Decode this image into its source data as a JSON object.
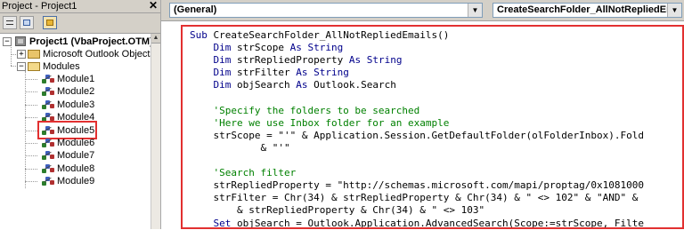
{
  "explorer": {
    "title": "Project - Project1",
    "close_glyph": "✕",
    "toolbar": [
      {
        "name": "view-code-button",
        "icon": "view-code-icon"
      },
      {
        "name": "view-object-button",
        "icon": "view-object-icon"
      },
      {
        "name": "toggle-folders-button",
        "icon": "folder-icon"
      }
    ],
    "tree": {
      "project": "Project1 (VbaProject.OTM)",
      "outlook_objects": "Microsoft Outlook Objects",
      "modules_folder": "Modules",
      "modules": [
        "Module1",
        "Module2",
        "Module3",
        "Module4",
        "Module5",
        "Module6",
        "Module7",
        "Module8",
        "Module9"
      ],
      "selected_module": "Module5",
      "expanded_glyph": "−",
      "collapsed_glyph": "+"
    },
    "highlight_color": "#e23030"
  },
  "code": {
    "object_combo": "(General)",
    "procedure_combo": "CreateSearchFolder_AllNotRepliedEmails",
    "dropdown_glyph": "▼",
    "lines": [
      [
        {
          "t": "Sub ",
          "c": "kw"
        },
        {
          "t": "CreateSearchFolder_AllNotRepliedEmails()",
          "c": ""
        }
      ],
      [
        {
          "t": "    ",
          "c": ""
        },
        {
          "t": "Dim ",
          "c": "kw"
        },
        {
          "t": "strScope ",
          "c": ""
        },
        {
          "t": "As String",
          "c": "kw"
        }
      ],
      [
        {
          "t": "    ",
          "c": ""
        },
        {
          "t": "Dim ",
          "c": "kw"
        },
        {
          "t": "strRepliedProperty ",
          "c": ""
        },
        {
          "t": "As String",
          "c": "kw"
        }
      ],
      [
        {
          "t": "    ",
          "c": ""
        },
        {
          "t": "Dim ",
          "c": "kw"
        },
        {
          "t": "strFilter ",
          "c": ""
        },
        {
          "t": "As String",
          "c": "kw"
        }
      ],
      [
        {
          "t": "    ",
          "c": ""
        },
        {
          "t": "Dim ",
          "c": "kw"
        },
        {
          "t": "objSearch ",
          "c": ""
        },
        {
          "t": "As ",
          "c": "kw"
        },
        {
          "t": "Outlook.Search",
          "c": ""
        }
      ],
      [
        {
          "t": "",
          "c": ""
        }
      ],
      [
        {
          "t": "    'Specify the folders to be searched",
          "c": "cm"
        }
      ],
      [
        {
          "t": "    'Here we use Inbox folder for an example",
          "c": "cm"
        }
      ],
      [
        {
          "t": "    strScope = \"'\" & Application.Session.GetDefaultFolder(olFolderInbox).Fold",
          "c": ""
        }
      ],
      [
        {
          "t": "            & \"'\"",
          "c": ""
        }
      ],
      [
        {
          "t": "",
          "c": ""
        }
      ],
      [
        {
          "t": "    'Search filter",
          "c": "cm"
        }
      ],
      [
        {
          "t": "    strRepliedProperty = \"http://schemas.microsoft.com/mapi/proptag/0x1081000",
          "c": ""
        }
      ],
      [
        {
          "t": "    strFilter = Chr(34) & strRepliedProperty & Chr(34) & \" <> 102\" & \"AND\" &",
          "c": ""
        }
      ],
      [
        {
          "t": "        & strRepliedProperty & Chr(34) & \" <> 103\"",
          "c": ""
        }
      ],
      [
        {
          "t": "    ",
          "c": ""
        },
        {
          "t": "Set ",
          "c": "kw"
        },
        {
          "t": "objSearch = Outlook.Application.AdvancedSearch(Scope:=strScope, Filte",
          "c": ""
        }
      ]
    ],
    "keyword_color": "#00008b",
    "comment_color": "#008000"
  }
}
